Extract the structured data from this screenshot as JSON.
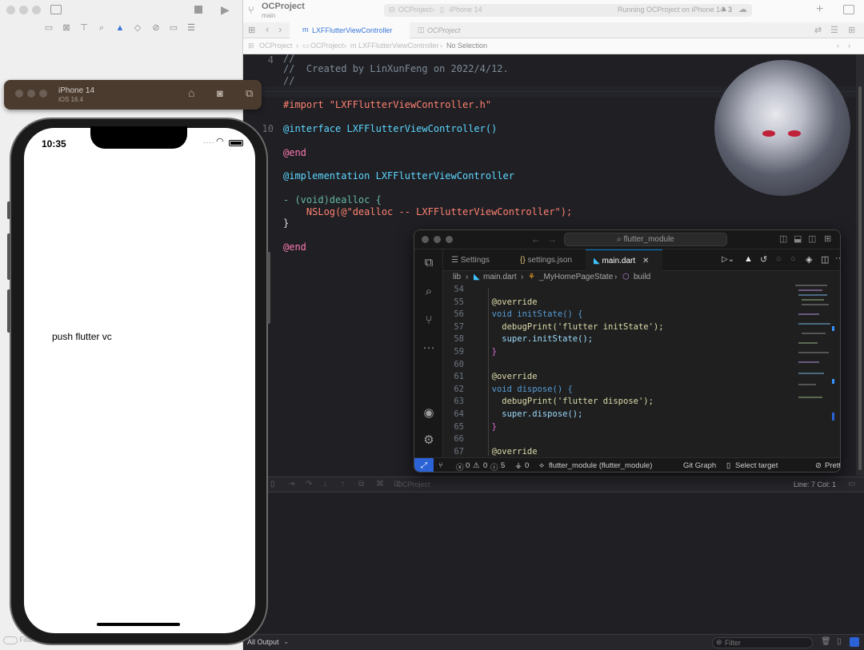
{
  "xcode": {
    "project_name": "OCProject",
    "branch": "main",
    "scheme_path": [
      "OCProject",
      "iPhone 14"
    ],
    "run_status": "Running OCProject on iPhone 14",
    "warning_count": "3",
    "tabs": [
      {
        "label": "LXFFlutterViewController",
        "active": true
      },
      {
        "label": "OCProject",
        "active": false
      }
    ],
    "jumpbar": [
      "OCProject",
      "OCProject",
      "LXFFlutterViewController",
      "No Selection"
    ],
    "code_lines": [
      {
        "n": "",
        "text": "//"
      },
      {
        "n": "",
        "text": "//  Created by LinXunFeng on 2022/4/12."
      },
      {
        "n": "",
        "text": "//"
      },
      {
        "n": "",
        "text": ""
      },
      {
        "n": "",
        "text": "#import \"LXFFlutterViewController.h\""
      },
      {
        "n": "",
        "text": ""
      },
      {
        "n": "10",
        "text": "@interface LXFFlutterViewController()"
      },
      {
        "n": "",
        "text": ""
      },
      {
        "n": "",
        "text": "@end"
      },
      {
        "n": "",
        "text": ""
      },
      {
        "n": "",
        "text": "@implementation LXFFlutterViewController"
      },
      {
        "n": "",
        "text": ""
      },
      {
        "n": "",
        "text": "- (void)dealloc {"
      },
      {
        "n": "",
        "text": "    NSLog(@\"dealloc -- LXFFlutterViewController\");"
      },
      {
        "n": "",
        "text": "}"
      },
      {
        "n": "",
        "text": ""
      },
      {
        "n": "",
        "text": "@end"
      }
    ],
    "cursor_position": "Line: 7  Col: 1",
    "debug_target": "OCProject",
    "console_output_selector": "All Output",
    "console_filter_placeholder": "Filter",
    "navigator_filter_placeholder": "Filter",
    "colors": {
      "editor_bg": "#1f1f24",
      "keyword": "#ff7ab2",
      "type": "#5dd8ff",
      "string": "#ff8170",
      "comment": "#7f8c98"
    }
  },
  "simulator": {
    "device": "iPhone 14",
    "os": "iOS 16.4",
    "time": "10:35",
    "button_label": "push flutter vc"
  },
  "vscode": {
    "search_text": "flutter_module",
    "tabs": [
      {
        "label": "Settings",
        "icon": "settings-icon"
      },
      {
        "label": "settings.json",
        "icon": "json-icon"
      },
      {
        "label": "main.dart",
        "icon": "dart-icon",
        "active": true
      }
    ],
    "breadcrumbs": [
      "lib",
      "main.dart",
      "_MyHomePageState",
      "build"
    ],
    "code_lines": [
      {
        "n": "54",
        "text": ""
      },
      {
        "n": "55",
        "text": "  @override"
      },
      {
        "n": "56",
        "text": "  void initState() {"
      },
      {
        "n": "57",
        "text": "    debugPrint('flutter initState');"
      },
      {
        "n": "58",
        "text": "    super.initState();"
      },
      {
        "n": "59",
        "text": "  }"
      },
      {
        "n": "60",
        "text": ""
      },
      {
        "n": "61",
        "text": "  @override"
      },
      {
        "n": "62",
        "text": "  void dispose() {"
      },
      {
        "n": "63",
        "text": "    debugPrint('flutter dispose');"
      },
      {
        "n": "64",
        "text": "    super.dispose();"
      },
      {
        "n": "65",
        "text": "  }"
      },
      {
        "n": "66",
        "text": ""
      },
      {
        "n": "67",
        "text": "  @override"
      }
    ],
    "status": {
      "errors": "0",
      "warnings": "0",
      "infos": "5",
      "ports": "0",
      "project": "flutter_module (flutter_module)",
      "git_graph": "Git Graph",
      "target": "Select target",
      "prettier": "Prett"
    },
    "colors": {
      "bg": "#1f1f1f",
      "accent": "#0078d4",
      "remote": "#2b63d6"
    }
  }
}
